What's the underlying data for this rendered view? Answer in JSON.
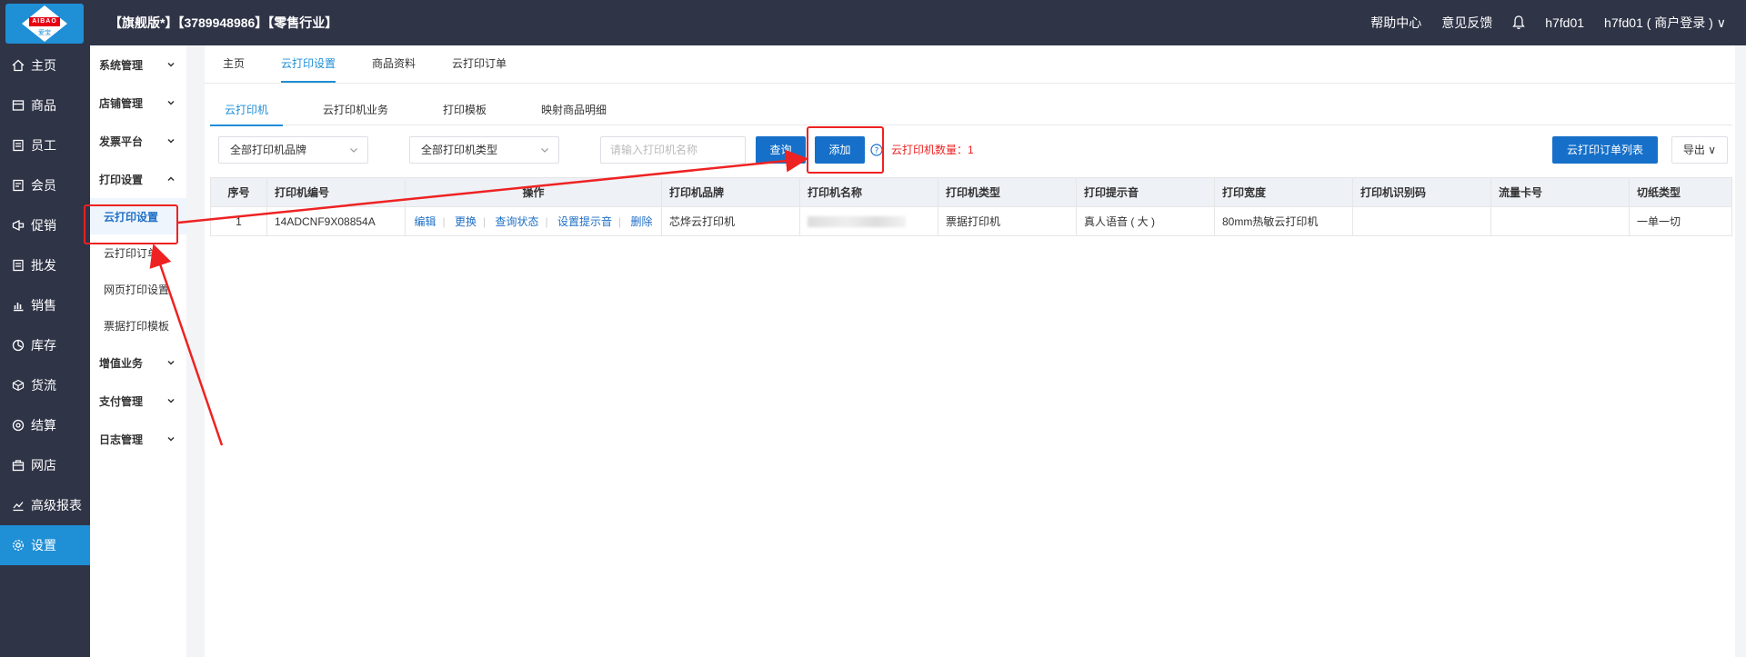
{
  "header": {
    "logo_text": "AIBAO",
    "logo_sub": "爱宝",
    "title": "【旗舰版*】【3789948986】【零售行业】",
    "links": [
      "帮助中心",
      "意见反馈"
    ],
    "user_short": "h7fd01",
    "user_full": "h7fd01 ( 商户登录 )"
  },
  "rail": [
    {
      "label": "主页",
      "icon": "home-icon"
    },
    {
      "label": "商品",
      "icon": "goods-icon"
    },
    {
      "label": "员工",
      "icon": "staff-icon"
    },
    {
      "label": "会员",
      "icon": "member-icon"
    },
    {
      "label": "促销",
      "icon": "promo-icon"
    },
    {
      "label": "批发",
      "icon": "wholesale-icon"
    },
    {
      "label": "销售",
      "icon": "sales-icon"
    },
    {
      "label": "库存",
      "icon": "stock-icon"
    },
    {
      "label": "货流",
      "icon": "logistics-icon"
    },
    {
      "label": "结算",
      "icon": "settle-icon"
    },
    {
      "label": "网店",
      "icon": "shop-icon"
    },
    {
      "label": "高级报表",
      "icon": "report-icon"
    },
    {
      "label": "设置",
      "icon": "settings-icon",
      "active": true
    }
  ],
  "submenu": {
    "groups": [
      "系统管理",
      "店铺管理",
      "发票平台",
      "打印设置",
      "增值业务",
      "支付管理",
      "日志管理"
    ],
    "print_children": [
      "云打印设置",
      "云打印订单",
      "网页打印设置",
      "票据打印模板"
    ]
  },
  "page_tabs": [
    "主页",
    "云打印设置",
    "商品资料",
    "云打印订单"
  ],
  "sub_tabs": [
    "云打印机",
    "云打印机业务",
    "打印模板",
    "映射商品明细"
  ],
  "toolbar": {
    "brand_select": "全部打印机品牌",
    "type_select": "全部打印机类型",
    "name_placeholder": "请输入打印机名称",
    "query": "查询",
    "add": "添加",
    "count_label": "云打印机数量：1",
    "order_list": "云打印订单列表",
    "export": "导出"
  },
  "table": {
    "headers": [
      "序号",
      "打印机编号",
      "操作",
      "打印机品牌",
      "打印机名称",
      "打印机类型",
      "打印提示音",
      "打印宽度",
      "打印机识别码",
      "流量卡号",
      "切纸类型"
    ],
    "rows": [
      {
        "index": "1",
        "code": "14ADCNF9X08854A",
        "ops": [
          "编辑",
          "更换",
          "查询状态",
          "设置提示音",
          "删除"
        ],
        "brand": "芯烨云打印机",
        "name": "",
        "type": "票据打印机",
        "sound": "真人语音 ( 大 )",
        "width": "80mm热敏云打印机",
        "ident": "",
        "sim": "",
        "cut": "一单一切"
      }
    ]
  },
  "colors": {
    "topbar": "#2f3447",
    "accent": "#1f8fd6",
    "primary_button": "#1670c9",
    "annotation": "#e22222"
  }
}
